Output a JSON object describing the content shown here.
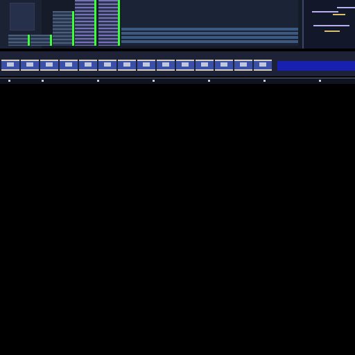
{
  "window": {
    "title": ""
  },
  "colors": {
    "background": "#000000",
    "panel": "#161b2a",
    "meter_accent": "#3cff3c",
    "toolbar_blue": "#1820b0",
    "note_lilac": "#b8aef0"
  },
  "icons": {
    "meter": "level-meter-icon",
    "track": "track-lane",
    "tool": "toolbar-button-icon"
  }
}
